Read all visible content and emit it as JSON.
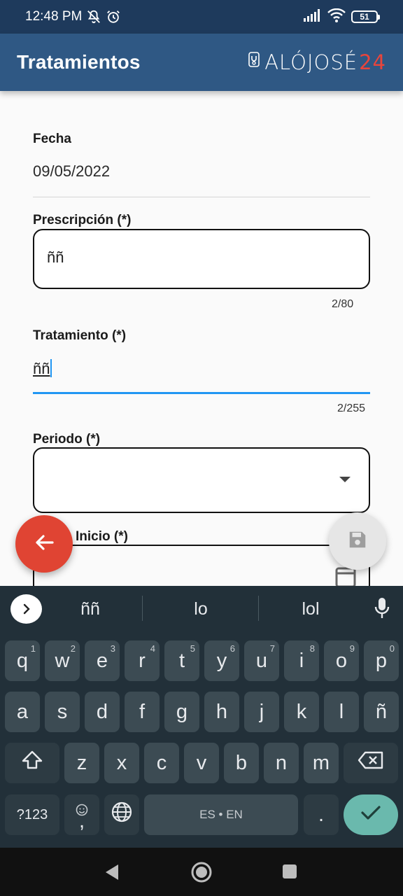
{
  "status_bar": {
    "time": "12:48 PM",
    "icons_left": [
      "notifications-off-icon",
      "alarm-icon"
    ],
    "icons_right": [
      "signal-icon",
      "wifi-icon"
    ],
    "battery": "51"
  },
  "app_bar": {
    "title": "Tratamientos",
    "logo_part1": "ALÓJOSÉ",
    "logo_part2": "24",
    "logo_color": "#e8453c",
    "background": "#2f5884"
  },
  "form": {
    "fecha": {
      "label": "Fecha",
      "value": "09/05/2022"
    },
    "prescripcion": {
      "label": "Prescripción (*)",
      "value": "ññ",
      "counter": "2/80"
    },
    "tratamiento": {
      "label": "Tratamiento (*)",
      "value": "ññ",
      "counter": "2/255"
    },
    "periodo": {
      "label": "Periodo (*)",
      "value": ""
    },
    "inicio": {
      "label": "Inicio (*)"
    }
  },
  "keyboard": {
    "suggestions": [
      "ññ",
      "lo",
      "lol"
    ],
    "row1": [
      {
        "k": "q",
        "s": "1"
      },
      {
        "k": "w",
        "s": "2"
      },
      {
        "k": "e",
        "s": "3"
      },
      {
        "k": "r",
        "s": "4"
      },
      {
        "k": "t",
        "s": "5"
      },
      {
        "k": "y",
        "s": "6"
      },
      {
        "k": "u",
        "s": "7"
      },
      {
        "k": "i",
        "s": "8"
      },
      {
        "k": "o",
        "s": "9"
      },
      {
        "k": "p",
        "s": "0"
      }
    ],
    "row2": [
      "a",
      "s",
      "d",
      "f",
      "g",
      "h",
      "j",
      "k",
      "l",
      "ñ"
    ],
    "row3": [
      "z",
      "x",
      "c",
      "v",
      "b",
      "n",
      "m"
    ],
    "symbols_label": "?123",
    "emoji_comma": ",",
    "space_label": "ES • EN",
    "period": ".",
    "enter_color": "#6ab9ad"
  }
}
